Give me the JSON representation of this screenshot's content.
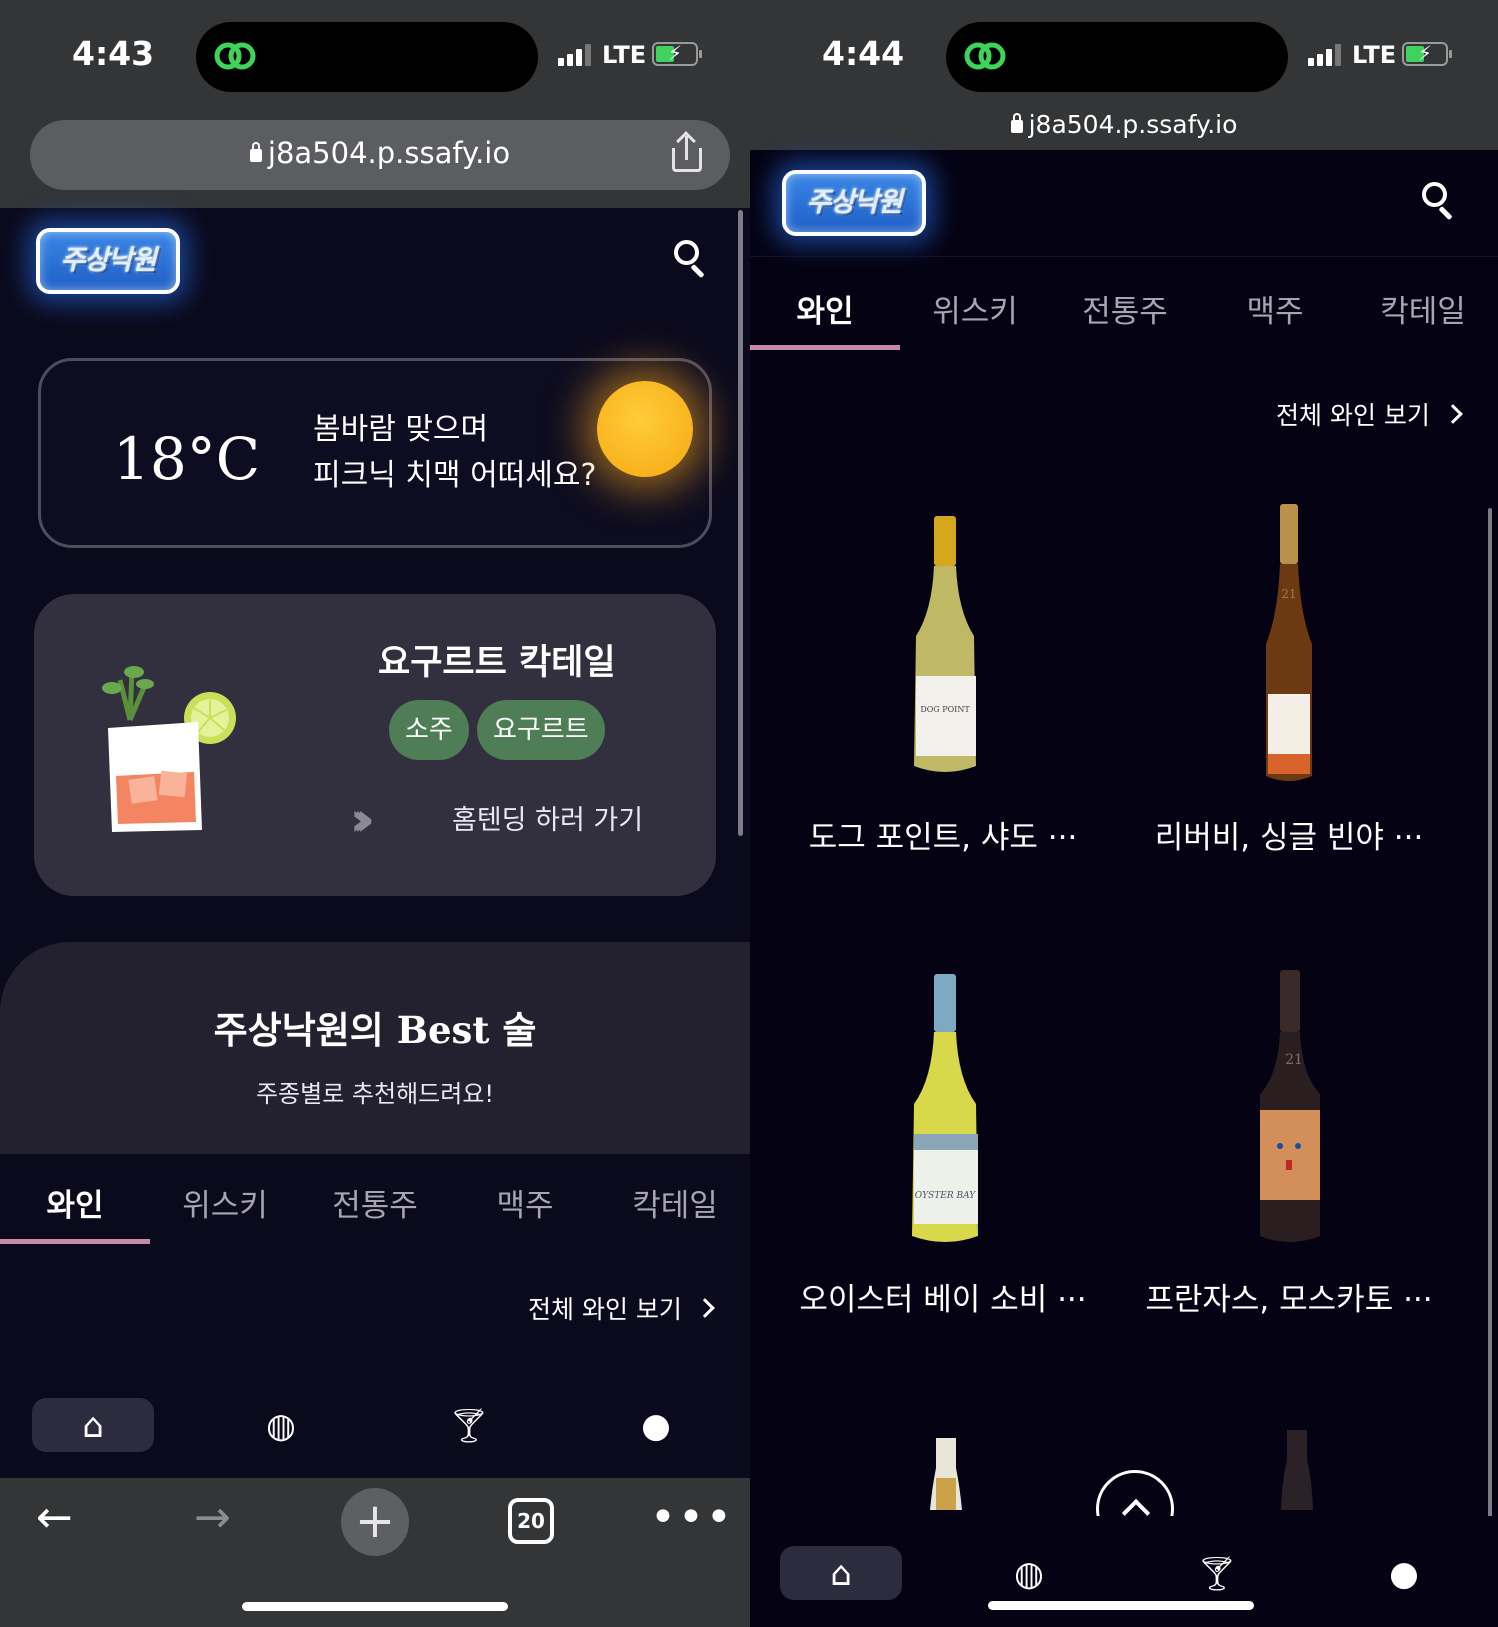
{
  "left": {
    "status": {
      "time": "4:43",
      "network": "LTE"
    },
    "url": "j8a504.p.ssafy.io",
    "logo_text": "주상낙원",
    "weather": {
      "temperature": "18°C",
      "line1": "봄바람 맞으며",
      "line2": "피크닉 치맥 어떠세요?"
    },
    "cocktail": {
      "title": "요구르트 칵테일",
      "tags": [
        "소주",
        "요구르트"
      ],
      "cta": "홈텐딩 하러 가기"
    },
    "best": {
      "title_prefix": "주상낙원의 ",
      "title_serif": "Best",
      "title_suffix": " 술",
      "subtitle": "주종별로 추천해드려요!"
    },
    "tabs": [
      "와인",
      "위스키",
      "전통주",
      "맥주",
      "칵테일"
    ],
    "active_tab": "와인",
    "see_all": "전체 와인 보기",
    "browser": {
      "tab_count": "20"
    }
  },
  "right": {
    "status": {
      "time": "4:44",
      "network": "LTE"
    },
    "url": "j8a504.p.ssafy.io",
    "logo_text": "주상낙원",
    "tabs": [
      "와인",
      "위스키",
      "전통주",
      "맥주",
      "칵테일"
    ],
    "active_tab": "와인",
    "see_all": "전체 와인 보기",
    "products": [
      {
        "name": "도그 포인트, 샤도 ···"
      },
      {
        "name": "리버비, 싱글 빈야 ···"
      },
      {
        "name": "오이스터 베이 소비 ···"
      },
      {
        "name": "프란자스, 모스카토 ···"
      }
    ],
    "bottle_labels": [
      "DOG POINT",
      "21",
      "OYSTER BAY",
      "21"
    ]
  },
  "nav_icons": [
    "home-icon",
    "globe-icon",
    "cocktail-glass-icon",
    "profile-icon"
  ],
  "colors": {
    "accent_tab": "#c48aa8",
    "tag_green": "#4f7d56",
    "sun": "#f5a810",
    "logo_blue": "#2f7ae0",
    "island_link": "#3fd35b"
  }
}
